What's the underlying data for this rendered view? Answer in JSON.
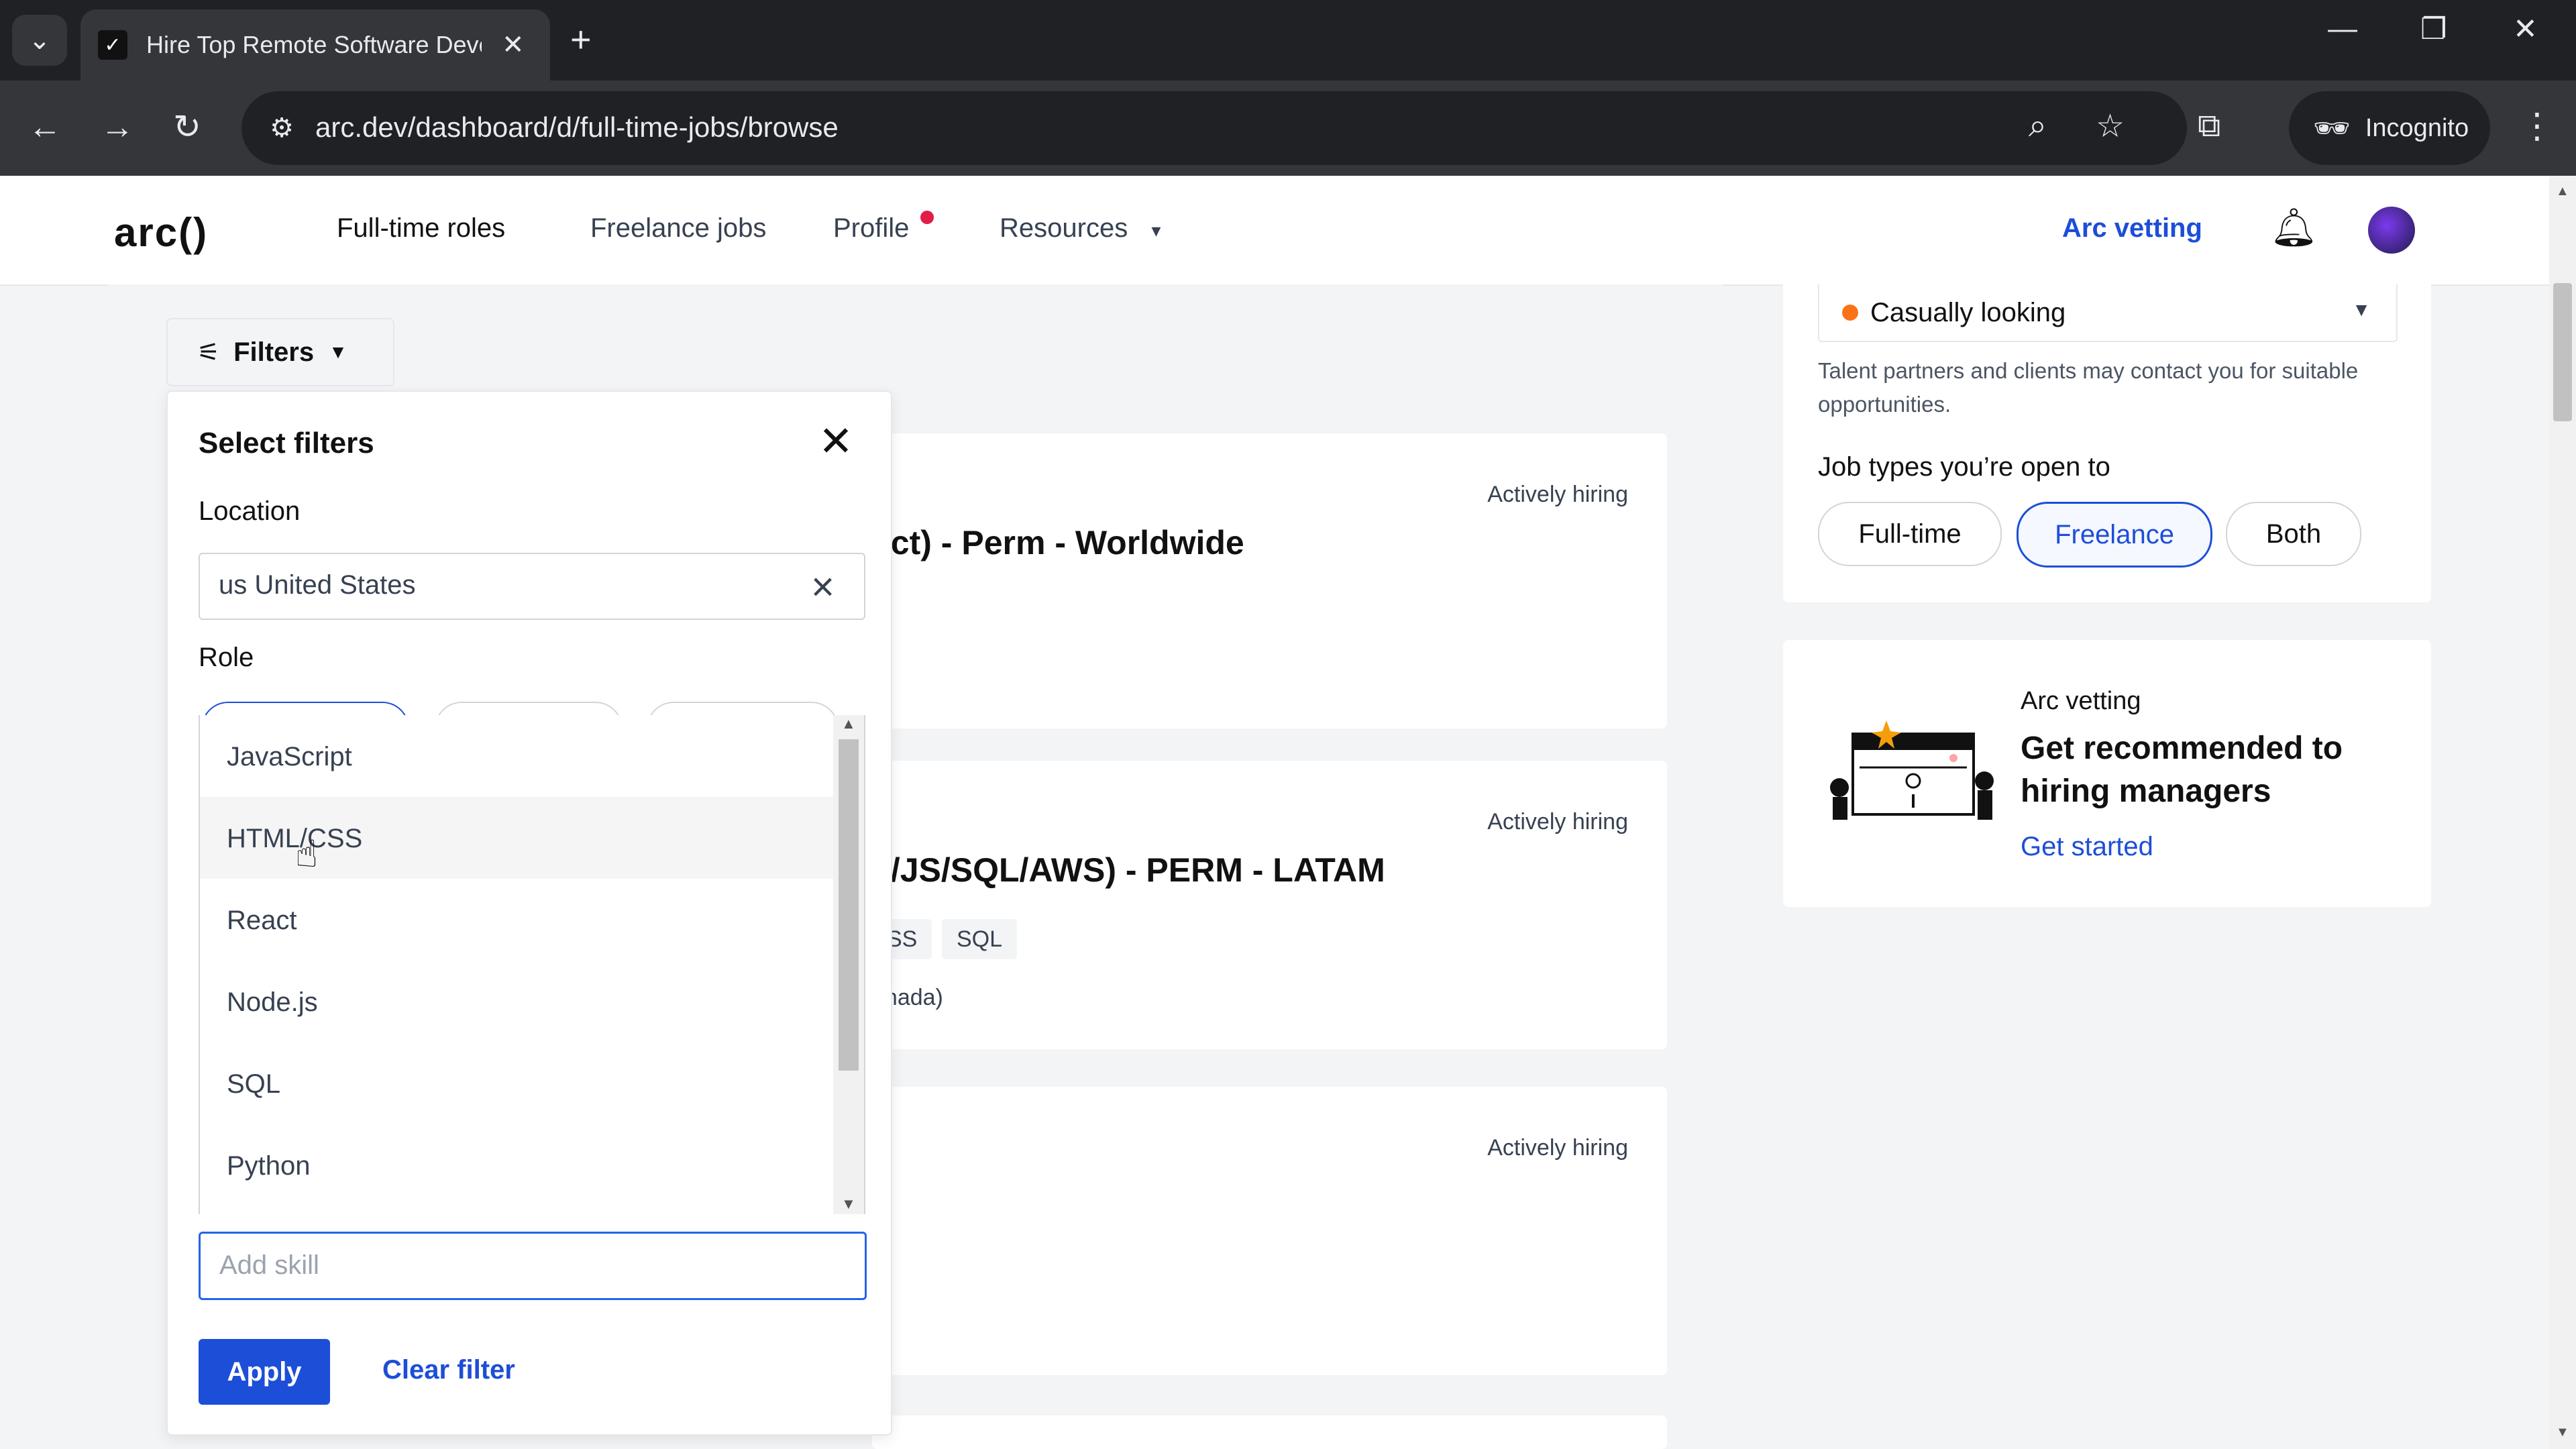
{
  "browser": {
    "tab_title": "Hire Top Remote Software Deve",
    "url": "arc.dev/dashboard/d/full-time-jobs/browse",
    "incognito_label": "Incognito"
  },
  "header": {
    "logo": "arc()",
    "nav": [
      "Full-time roles",
      "Freelance jobs",
      "Profile",
      "Resources"
    ],
    "arc_vetting": "Arc vetting"
  },
  "filters_button": "Filters",
  "filter_panel": {
    "title": "Select filters",
    "location_label": "Location",
    "location_value": "us United States",
    "role_label": "Role",
    "skills": [
      "JavaScript",
      "HTML/CSS",
      "React",
      "Node.js",
      "SQL",
      "Python"
    ],
    "skill_placeholder": "Add skill",
    "apply": "Apply",
    "clear": "Clear filter"
  },
  "jobs": [
    {
      "status": "Actively hiring",
      "title_fragment": "act) - Perm - Worldwide"
    },
    {
      "status": "Actively hiring",
      "title_fragment": "s/JS/SQL/AWS) - PERM - LATAM",
      "tags": [
        "SS",
        "SQL"
      ],
      "location_fragment": "anada)"
    },
    {
      "status": "Actively hiring"
    }
  ],
  "sidebar": {
    "status_value": "Casually looking",
    "status_note": "Talent partners and clients may contact you for suitable opportunities.",
    "job_types_heading": "Job types you’re open to",
    "job_types": [
      "Full-time",
      "Freelance",
      "Both"
    ],
    "selected_job_type": "Freelance",
    "vetting_small": "Arc vetting",
    "vetting_big": "Get recommended to hiring managers",
    "vetting_link": "Get started"
  },
  "colors": {
    "accent": "#1d4ed8",
    "status_dot": "#f97316",
    "notification_dot": "#e11d48"
  }
}
